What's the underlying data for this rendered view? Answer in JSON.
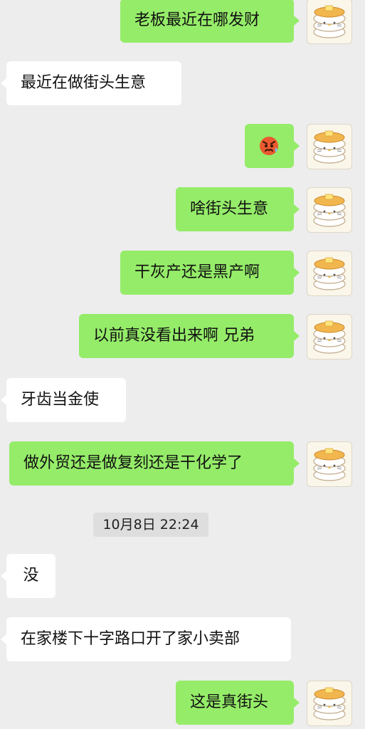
{
  "chat": {
    "messages": [
      {
        "side": "sent",
        "text": "老板最近在哪发财"
      },
      {
        "side": "recv",
        "text": "最近在做街头生意"
      },
      {
        "side": "sent",
        "emoji": "angry-sweat-face-emoji"
      },
      {
        "side": "sent",
        "text": "啥街头生意"
      },
      {
        "side": "sent",
        "text": "干灰产还是黑产啊"
      },
      {
        "side": "sent",
        "text": "以前真没看出来啊 兄弟"
      },
      {
        "side": "recv",
        "text": "牙齿当金使"
      },
      {
        "side": "sent",
        "text": "做外贸还是做复刻还是干化学了"
      },
      {
        "side": "recv",
        "text": "没"
      },
      {
        "side": "recv",
        "text": "在家楼下十字路口开了家小卖部"
      },
      {
        "side": "sent",
        "text": "这是真街头"
      }
    ],
    "timestamp": "10月8日 22:24"
  },
  "colors": {
    "background": "#ededed",
    "sent_bubble": "#95ec69",
    "received_bubble": "#ffffff",
    "timestamp_chip": "#dedede"
  },
  "icons": {
    "avatar": "pancake-kitty-avatar-icon"
  }
}
